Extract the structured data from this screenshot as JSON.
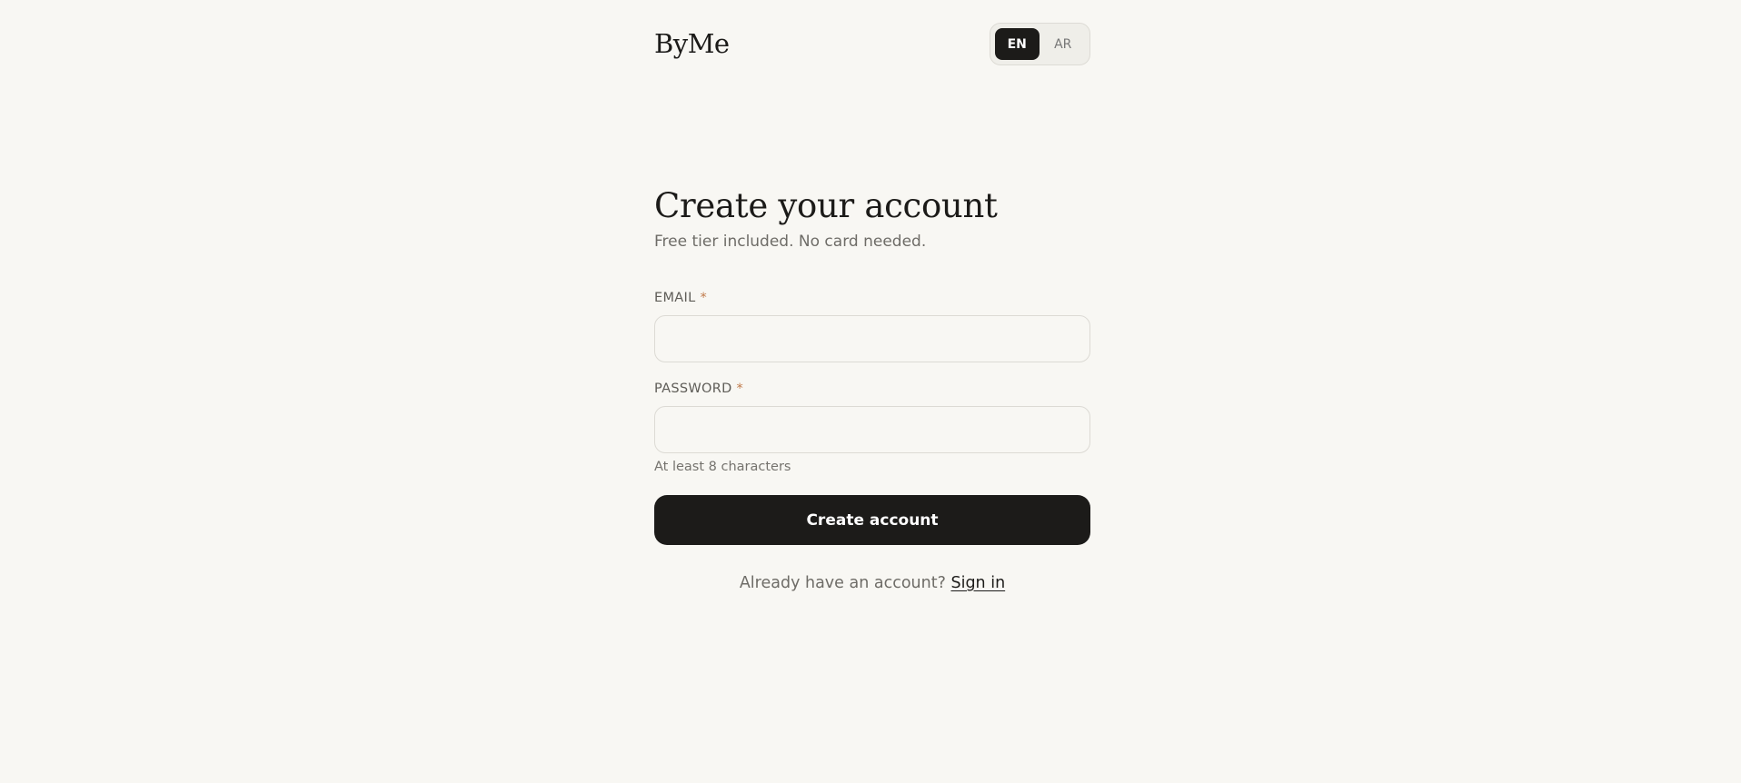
{
  "header": {
    "logo": "ByMe",
    "languages": [
      {
        "label": "EN",
        "active": true
      },
      {
        "label": "AR",
        "active": false
      }
    ]
  },
  "form": {
    "title": "Create your account",
    "subtitle": "Free tier included. No card needed.",
    "email": {
      "label": "EMAIL",
      "required_mark": "*",
      "value": "",
      "placeholder": ""
    },
    "password": {
      "label": "PASSWORD",
      "required_mark": "*",
      "value": "",
      "placeholder": "",
      "hint": "At least 8 characters"
    },
    "submit_label": "Create account",
    "footer": {
      "prompt": "Already have an account?",
      "link_label": "Sign in"
    }
  },
  "colors": {
    "background": "#f8f7f3",
    "primary": "#1c1b19",
    "required_accent": "#c07a4a",
    "muted_text": "#6e6c67"
  }
}
